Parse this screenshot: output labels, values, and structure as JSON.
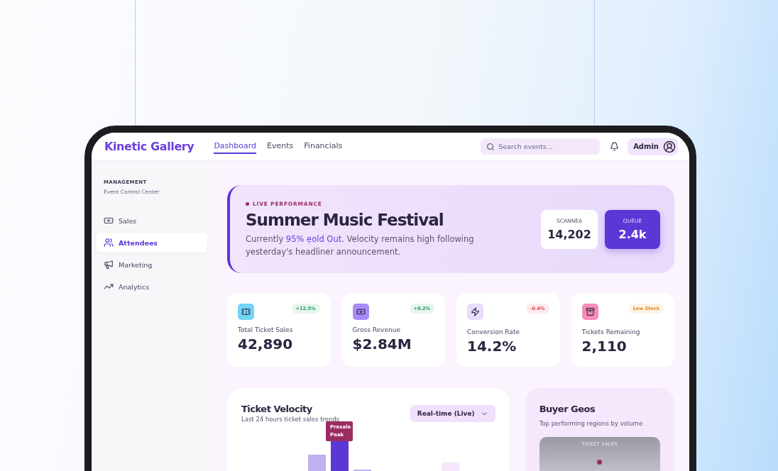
{
  "brand": "Kinetic Gallery",
  "nav": [
    {
      "label": "Dashboard",
      "selected": true
    },
    {
      "label": "Events",
      "selected": false
    },
    {
      "label": "Financials",
      "selected": false
    }
  ],
  "search": {
    "placeholder": "Search events..."
  },
  "user": {
    "label": "Admin"
  },
  "sidebar": {
    "heading": "MANAGEMENT",
    "subheading": "Event Control Center",
    "items": [
      {
        "label": "Sales",
        "selected": false
      },
      {
        "label": "Attendees",
        "selected": true
      },
      {
        "label": "Marketing",
        "selected": false
      },
      {
        "label": "Analytics",
        "selected": false
      }
    ]
  },
  "hero": {
    "eyebrow": "LIVE PERFORMANCE",
    "title": "Summer Music Festival",
    "lead": "Currently ",
    "highlight": "95% ẹold Out",
    "rest": ". Velocity remains high following yesterday's headliner announcement.",
    "stats": [
      {
        "label": "SCANNEẠ",
        "value": "14,202",
        "selected": false
      },
      {
        "label": "QUEUE",
        "value": "2.4k",
        "selected": true
      }
    ]
  },
  "metrics": [
    {
      "label": "Total Ticket Sales",
      "value": "42,890",
      "badge": "+12.5%",
      "color": "#1e9c5a"
    },
    {
      "label": "Gross Revenue",
      "value": "$2.84M",
      "badge": "+8.2%",
      "color": "#1e9c5a"
    },
    {
      "label": "Conversion Rate",
      "value": "14.2%",
      "badge": "-0.4%",
      "color": "#e0404f"
    },
    {
      "label": "Tickets Remaining",
      "value": "2,110",
      "badge": "Low Stock",
      "color": "#e08a10"
    }
  ],
  "velocity": {
    "title": "Ticket Velocity",
    "subtitle": "Last 24 hours ticket sales trends",
    "range": "Real-time (Live)",
    "tooltip": "Presale Peak"
  },
  "geos": {
    "title": "Buyer Geos",
    "subtitle": "Top performing regions by volume",
    "map_label": "TICKET SALES"
  }
}
